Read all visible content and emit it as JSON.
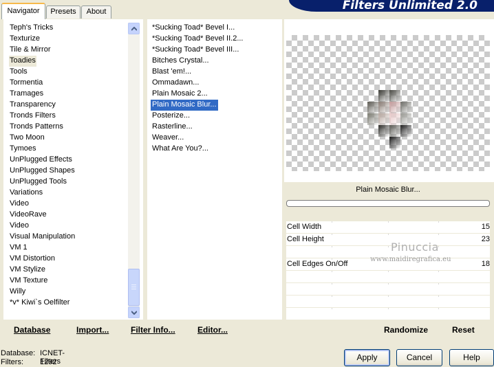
{
  "tabs": [
    {
      "label": "Navigator",
      "active": true
    },
    {
      "label": "Presets",
      "active": false
    },
    {
      "label": "About",
      "active": false
    }
  ],
  "app_title": "Filters Unlimited 2.0",
  "categories": [
    {
      "label": "Teph's Tricks"
    },
    {
      "label": "Texturize"
    },
    {
      "label": "Tile & Mirror"
    },
    {
      "label": "Toadies",
      "selected": true
    },
    {
      "label": "Tools"
    },
    {
      "label": "Tormentia"
    },
    {
      "label": "Tramages"
    },
    {
      "label": "Transparency"
    },
    {
      "label": "Tronds Filters"
    },
    {
      "label": "Tronds Patterns"
    },
    {
      "label": "Two Moon"
    },
    {
      "label": "Tymoes"
    },
    {
      "label": "UnPlugged Effects"
    },
    {
      "label": "UnPlugged Shapes"
    },
    {
      "label": "UnPlugged Tools"
    },
    {
      "label": "Variations"
    },
    {
      "label": "Video"
    },
    {
      "label": "VideoRave"
    },
    {
      "label": "Video"
    },
    {
      "label": "Visual Manipulation"
    },
    {
      "label": "VM 1"
    },
    {
      "label": "VM Distortion"
    },
    {
      "label": "VM Stylize"
    },
    {
      "label": "VM Texture"
    },
    {
      "label": "Willy"
    },
    {
      "label": "*v* Kiwi`s Oelfilter"
    }
  ],
  "filters": [
    {
      "label": "*Sucking Toad*  Bevel I..."
    },
    {
      "label": "*Sucking Toad*  Bevel II.2..."
    },
    {
      "label": "*Sucking Toad*  Bevel III..."
    },
    {
      "label": "Bitches Crystal..."
    },
    {
      "label": "Blast 'em!..."
    },
    {
      "label": "Ommadawn..."
    },
    {
      "label": "Plain Mosaic 2..."
    },
    {
      "label": "Plain Mosaic Blur...",
      "selected": true
    },
    {
      "label": "Posterize..."
    },
    {
      "label": "Rasterline..."
    },
    {
      "label": "Weaver..."
    },
    {
      "label": "What Are You?..."
    }
  ],
  "left_buttons": {
    "database": "Database",
    "import": "Import...",
    "filter_info": "Filter Info...",
    "editor": "Editor..."
  },
  "filter_name": "Plain Mosaic Blur...",
  "params": [
    {
      "label": "Cell Width",
      "value": "15"
    },
    {
      "label": "Cell Height",
      "value": "23"
    },
    {
      "label": "",
      "value": ""
    },
    {
      "label": "Cell Edges On/Off",
      "value": "18"
    },
    {
      "label": "",
      "value": ""
    },
    {
      "label": "",
      "value": ""
    },
    {
      "label": "",
      "value": ""
    },
    {
      "label": "",
      "value": ""
    }
  ],
  "watermark": {
    "name": "Pinuccia",
    "site": "www.maidiregrafica.eu"
  },
  "right_buttons": {
    "randomize": "Randomize",
    "reset": "Reset"
  },
  "status": {
    "database_label": "Database:",
    "database_value": "ICNET-Filters",
    "filters_label": "Filters:",
    "filters_value": "1292"
  },
  "dialog_buttons": {
    "apply": "Apply",
    "cancel": "Cancel",
    "help": "Help"
  },
  "colors": {
    "selection": "#316ac5",
    "banner": "#08206b",
    "dialog_bg": "#ece9d8"
  }
}
